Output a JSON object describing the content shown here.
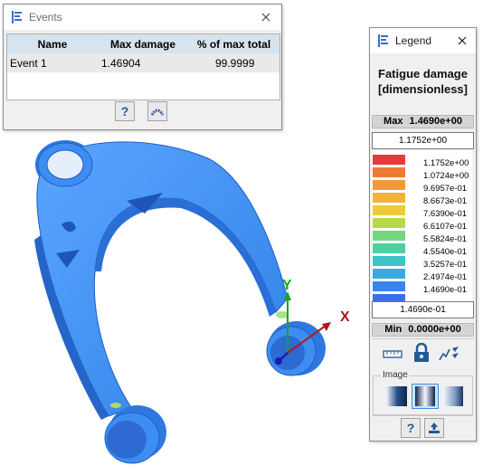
{
  "events_panel": {
    "title": "Events",
    "columns": [
      "Name",
      "Max damage",
      "% of max total"
    ],
    "rows": [
      {
        "name": "Event 1",
        "max_damage": "1.46904",
        "percent": "99.9999"
      }
    ],
    "help_label": "?"
  },
  "legend_panel": {
    "title": "Legend",
    "heading_line1": "Fatigue damage",
    "heading_line2": "[dimensionless]",
    "max_label": "Max",
    "max_value": "1.4690e+00",
    "upper_input": "1.1752e+00",
    "scale_labels": [
      "1.1752e+00",
      "1.0724e+00",
      "9.6957e-01",
      "8.6673e-01",
      "7.6390e-01",
      "6.6107e-01",
      "5.5824e-01",
      "4.5540e-01",
      "3.5257e-01",
      "2.4974e-01",
      "1.4690e-01"
    ],
    "scale_colors": [
      "#e83a3a",
      "#ee7a34",
      "#f09a3c",
      "#f2b23c",
      "#eecb32",
      "#b6d94a",
      "#74d680",
      "#4ecfa0",
      "#3bc3c8",
      "#3aa9e2",
      "#3b84ea",
      "#3b6fe6"
    ],
    "lower_input": "1.4690e-01",
    "min_label": "Min",
    "min_value": "0.0000e+00",
    "image_group_label": "Image",
    "help_label": "?"
  },
  "viewport": {
    "axis_x": "X",
    "axis_y": "Y",
    "part_color": "#3d8df2"
  }
}
